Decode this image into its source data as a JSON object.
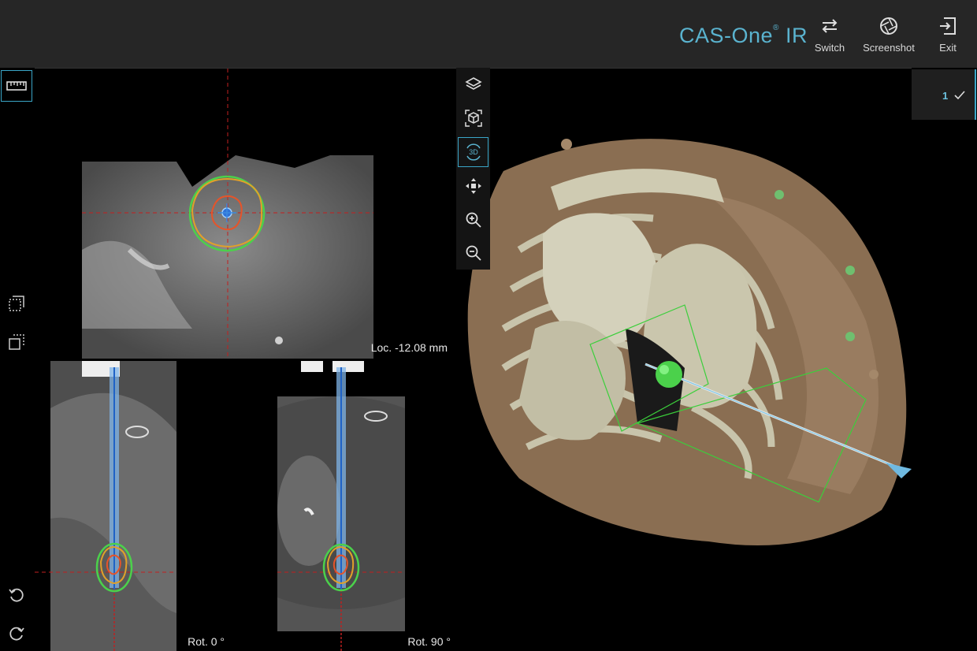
{
  "app": {
    "brand": "CAS-One",
    "brand_suffix": "IR",
    "accent": "#5ab3cf"
  },
  "toolbar": [
    {
      "label": "Switch",
      "icon": "swap-arrows-icon"
    },
    {
      "label": "Screenshot",
      "icon": "camera-shutter-icon"
    },
    {
      "label": "Exit",
      "icon": "exit-icon"
    }
  ],
  "left_tools": {
    "ruler": "ruler-icon",
    "slab_1": "dotted-frame-icon",
    "slab_2": "copy-frame-icon",
    "rotate_ccw": "rotate-ccw-icon",
    "rotate_cw": "rotate-cw-icon"
  },
  "views": {
    "axial": {
      "overlay": "Loc. -12.08 mm"
    },
    "rot0": {
      "overlay": "Rot. 0 °"
    },
    "rot90": {
      "overlay": "Rot. 90 °"
    }
  },
  "view3d_tools": [
    {
      "name": "layers-icon"
    },
    {
      "name": "reset-view-cube-icon"
    },
    {
      "name": "rotate-3d-icon",
      "label": "3D",
      "active": true
    },
    {
      "name": "pan-icon"
    },
    {
      "name": "zoom-in-icon"
    },
    {
      "name": "zoom-out-icon"
    }
  ],
  "trajectories": [
    {
      "number": "1",
      "status": "check-icon"
    }
  ]
}
